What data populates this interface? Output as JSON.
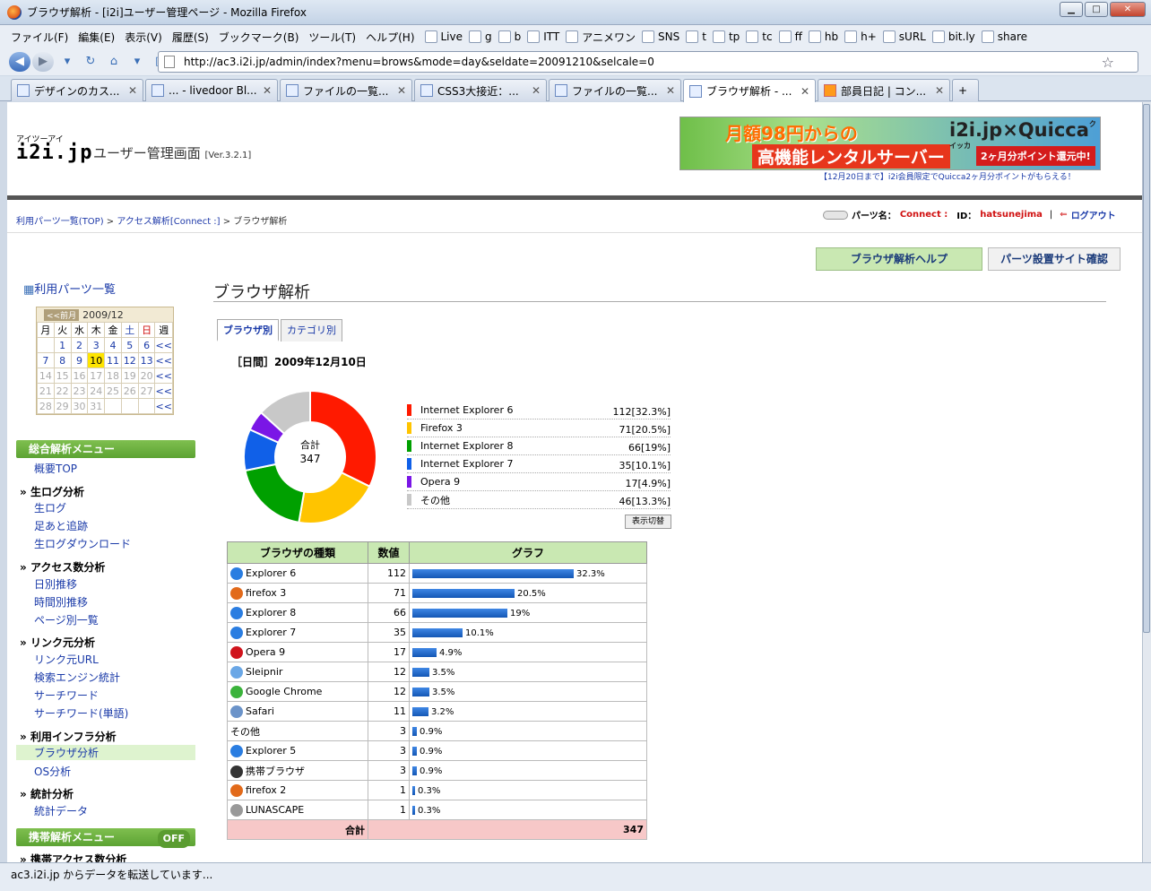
{
  "window": {
    "title": "ブラウザ解析 - [i2i]ユーザー管理ページ - Mozilla Firefox"
  },
  "menus": [
    "ファイル(F)",
    "編集(E)",
    "表示(V)",
    "履歴(S)",
    "ブックマーク(B)",
    "ツール(T)",
    "ヘルプ(H)"
  ],
  "bookmarks": [
    "Live",
    "g",
    "b",
    "ITT",
    "アニメワン",
    "SNS",
    "t",
    "tp",
    "tc",
    "ff",
    "hb",
    "h+",
    "sURL",
    "bit.ly",
    "share"
  ],
  "url": "http://ac3.i2i.jp/admin/index?menu=brows&mode=day&seldate=20091210&selcale=0",
  "tabs": [
    "デザインのカス...",
    "... - livedoor Bl...",
    "ファイルの一覧...",
    "CSS3大接近：...",
    "ファイルの一覧...",
    "ブラウザ解析 - ...",
    "部員日記 | コン..."
  ],
  "header": {
    "logo_ruby": "アイツーアイ",
    "logo": "i2i.jp",
    "app_title": "ユーザー管理画面",
    "version": "[Ver.3.2.1]"
  },
  "banner": {
    "line1": "月額98円からの",
    "line2": "高機能レンタルサーバー",
    "brand": "i2i.jp×Quicca",
    "ruby": "クイッカ",
    "badge": "2ヶ月分ポイント還元中!",
    "note": "【12月20日まで】i2i会員限定でQuicca2ヶ月分ポイントがもらえる！"
  },
  "breadcrumb": {
    "l1": "利用パーツ一覧(TOP)",
    "l2": "アクセス解析[Connect :]",
    "current": "ブラウザ解析"
  },
  "user": {
    "parts_label": "パーツ名：",
    "parts_name": "Connect :",
    "id_label": "ID：",
    "id": "hatsunejima",
    "logout": "ログアウト"
  },
  "buttons": {
    "help": "ブラウザ解析ヘルプ",
    "site": "パーツ設置サイト確認",
    "switch": "表示切替"
  },
  "sidebar": {
    "top": "利用パーツ一覧",
    "menu1": "総合解析メニュー",
    "overview": "概要TOP",
    "sec_raw": "生ログ分析",
    "raw_log": "生ログ",
    "footprint": "足あと追跡",
    "raw_download": "生ログダウンロード",
    "sec_access": "アクセス数分析",
    "daily": "日別推移",
    "hourly": "時間別推移",
    "perpage": "ページ別一覧",
    "sec_link": "リンク元分析",
    "link_url": "リンク元URL",
    "search_engine": "検索エンジン統計",
    "search_word": "サーチワード",
    "search_word2": "サーチワード(単語)",
    "sec_infra": "利用インフラ分析",
    "browser": "ブラウザ分析",
    "os": "OS分析",
    "sec_stats": "統計分析",
    "stats_data": "統計データ",
    "menu2": "携帯解析メニュー",
    "off": "OFF",
    "sec_mobile": "携帯アクセス数分析"
  },
  "calendar": {
    "prev": "<<前月",
    "month": "2009/12",
    "headers": [
      "月",
      "火",
      "水",
      "木",
      "金",
      "土",
      "日",
      "週"
    ],
    "rows": [
      [
        "",
        "1",
        "2",
        "3",
        "4",
        "5",
        "6",
        "<<"
      ],
      [
        "7",
        "8",
        "9",
        "10",
        "11",
        "12",
        "13",
        "<<"
      ],
      [
        "14",
        "15",
        "16",
        "17",
        "18",
        "19",
        "20",
        "<<"
      ],
      [
        "21",
        "22",
        "23",
        "24",
        "25",
        "26",
        "27",
        "<<"
      ],
      [
        "28",
        "29",
        "30",
        "31",
        "",
        "",
        "",
        "<<"
      ]
    ],
    "today": "10"
  },
  "page": {
    "title": "ブラウザ解析",
    "tab_browser": "ブラウザ別",
    "tab_category": "カテゴリ別",
    "date_label": "［日間］2009年12月10日",
    "total_label": "合計",
    "total": "347"
  },
  "colors": {
    "accent_green": "#5ca333",
    "bar_blue": "#1f6fd6"
  },
  "chart_data": [
    {
      "type": "pie",
      "title": "",
      "categories": [
        "Internet Explorer 6",
        "Firefox 3",
        "Internet Explorer 8",
        "Internet Explorer 7",
        "Opera 9",
        "その他"
      ],
      "values": [
        112,
        71,
        66,
        35,
        17,
        46
      ],
      "labels": [
        "112[32.3%]",
        "71[20.5%]",
        "66[19%]",
        "35[10.1%]",
        "17[4.9%]",
        "46[13.3%]"
      ],
      "colors": [
        "#ff1a00",
        "#ffc400",
        "#00a000",
        "#1060e8",
        "#7a16e6",
        "#c8c8c8"
      ]
    },
    {
      "type": "table",
      "headers": [
        "ブラウザの種類",
        "数値",
        "グラフ"
      ],
      "rows": [
        {
          "name": "Explorer 6",
          "value": 112,
          "pct": "32.3%",
          "icon": "ie-icon"
        },
        {
          "name": "firefox 3",
          "value": 71,
          "pct": "20.5%",
          "icon": "firefox-icon"
        },
        {
          "name": "Explorer 8",
          "value": 66,
          "pct": "19%",
          "icon": "ie-icon"
        },
        {
          "name": "Explorer 7",
          "value": 35,
          "pct": "10.1%",
          "icon": "ie-icon"
        },
        {
          "name": "Opera 9",
          "value": 17,
          "pct": "4.9%",
          "icon": "opera-icon"
        },
        {
          "name": "Sleipnir",
          "value": 12,
          "pct": "3.5%",
          "icon": "sleipnir-icon"
        },
        {
          "name": "Google Chrome",
          "value": 12,
          "pct": "3.5%",
          "icon": "chrome-icon"
        },
        {
          "name": "Safari",
          "value": 11,
          "pct": "3.2%",
          "icon": "safari-icon"
        },
        {
          "name": "その他",
          "value": 3,
          "pct": "0.9%",
          "icon": ""
        },
        {
          "name": "Explorer 5",
          "value": 3,
          "pct": "0.9%",
          "icon": "ie-icon"
        },
        {
          "name": "携帯ブラウザ",
          "value": 3,
          "pct": "0.9%",
          "icon": "mobile-icon"
        },
        {
          "name": "firefox 2",
          "value": 1,
          "pct": "0.3%",
          "icon": "firefox-icon"
        },
        {
          "name": "LUNASCAPE",
          "value": 1,
          "pct": "0.3%",
          "icon": "lunascape-icon"
        }
      ],
      "total_label": "合計",
      "total": 347
    }
  ],
  "status": "ac3.i2i.jp からデータを転送しています..."
}
